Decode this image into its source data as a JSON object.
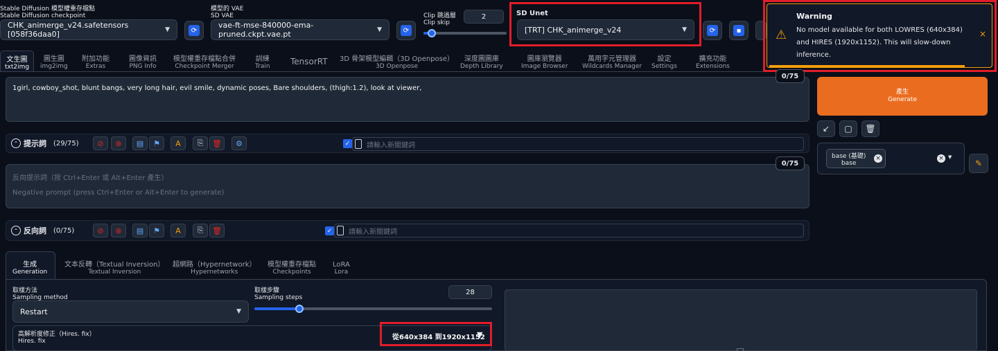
{
  "checkpoint": {
    "label_zh": "Stable Diffusion 模型權重存檔點",
    "label_en": "Stable Diffusion checkpoint",
    "value": "CHK_animerge_v24.safetensors [058f36daa0]"
  },
  "vae": {
    "label_zh": "模型的 VAE",
    "label_en": "SD VAE",
    "value": "vae-ft-mse-840000-ema-pruned.ckpt.vae.pt"
  },
  "clip_skip": {
    "label_zh": "Clip 跳過層",
    "label_en": "Clip skip",
    "value": "2",
    "level": 0.1
  },
  "unet": {
    "label": "SD Unet",
    "value": "[TRT] CHK_animerge_v24"
  },
  "warning": {
    "title": "Warning",
    "message": "No model available for both LOWRES (640x384) and HIRES (1920x1152). This will slow-down inference.",
    "close": "×"
  },
  "tabs": [
    {
      "zh": "文生圖",
      "en": "txt2img"
    },
    {
      "zh": "圖生圖",
      "en": "img2img"
    },
    {
      "zh": "附加功能",
      "en": "Extras"
    },
    {
      "zh": "圖像資訊",
      "en": "PNG Info"
    },
    {
      "zh": "模型權重存檔點合併",
      "en": "Checkpoint Merger"
    },
    {
      "zh": "訓練",
      "en": "Train"
    },
    {
      "zh": "TensorRT",
      "en": ""
    },
    {
      "zh": "3D 骨架模型編輯（3D Openpose）",
      "en": "3D Openpose"
    },
    {
      "zh": "深度圖圖庫",
      "en": "Depth Library"
    },
    {
      "zh": "圖庫瀏覽器",
      "en": "Image Browser"
    },
    {
      "zh": "萬用字元管理器",
      "en": "Wildcards Manager"
    },
    {
      "zh": "設定",
      "en": "Settings"
    },
    {
      "zh": "擴充功能",
      "en": "Extensions"
    }
  ],
  "prompt": {
    "text": "1girl, cowboy_shot, blunt bangs, very long hair, evil smile, dynamic poses, Bare shoulders, (thigh:1.2), look at viewer,",
    "counter": "0/75"
  },
  "prompt_tools": {
    "title": "提示詞",
    "count": "(29/75)",
    "keyword_placeholder": "請輸入新關鍵詞"
  },
  "negative": {
    "placeholder_zh": "反向提示詞（按 Ctrl+Enter 或 Alt+Enter 產生）",
    "placeholder_en": "Negative prompt (press Ctrl+Enter or Alt+Enter to generate)",
    "counter": "0/75"
  },
  "negative_tools": {
    "title": "反向詞",
    "count": "(0/75)",
    "keyword_placeholder": "請輸入新關鍵詞"
  },
  "generate": {
    "zh": "產生",
    "en": "Generate"
  },
  "styles": {
    "tag_zh": "base (基礎)",
    "tag_en": "base",
    "x": "×"
  },
  "subtabs": [
    {
      "zh": "生成",
      "en": "Generation"
    },
    {
      "zh": "文本反轉（Textual Inversion）",
      "en": "Textual Inversion"
    },
    {
      "zh": "超網路（Hypernetwork）",
      "en": "Hypernetworks"
    },
    {
      "zh": "模型權重存檔點",
      "en": "Checkpoints"
    },
    {
      "zh": "LoRA",
      "en": "Lora"
    }
  ],
  "sampling_method": {
    "label_zh": "取樣方法",
    "label_en": "Sampling method",
    "value": "Restart"
  },
  "sampling_steps": {
    "label_zh": "取樣步驟",
    "label_en": "Sampling steps",
    "value": "28",
    "level": 0.19
  },
  "hires": {
    "label_zh": "高解析度修正（Hires. fix）",
    "label_en": "Hires. fix",
    "summary": "從640x384 到1920x1152",
    "arrow": "▼"
  },
  "colors": {
    "accent": "#2563eb",
    "generate": "#ea6d1f",
    "highlight": "#e11d2a",
    "warning_bar": "#f59e0b"
  }
}
